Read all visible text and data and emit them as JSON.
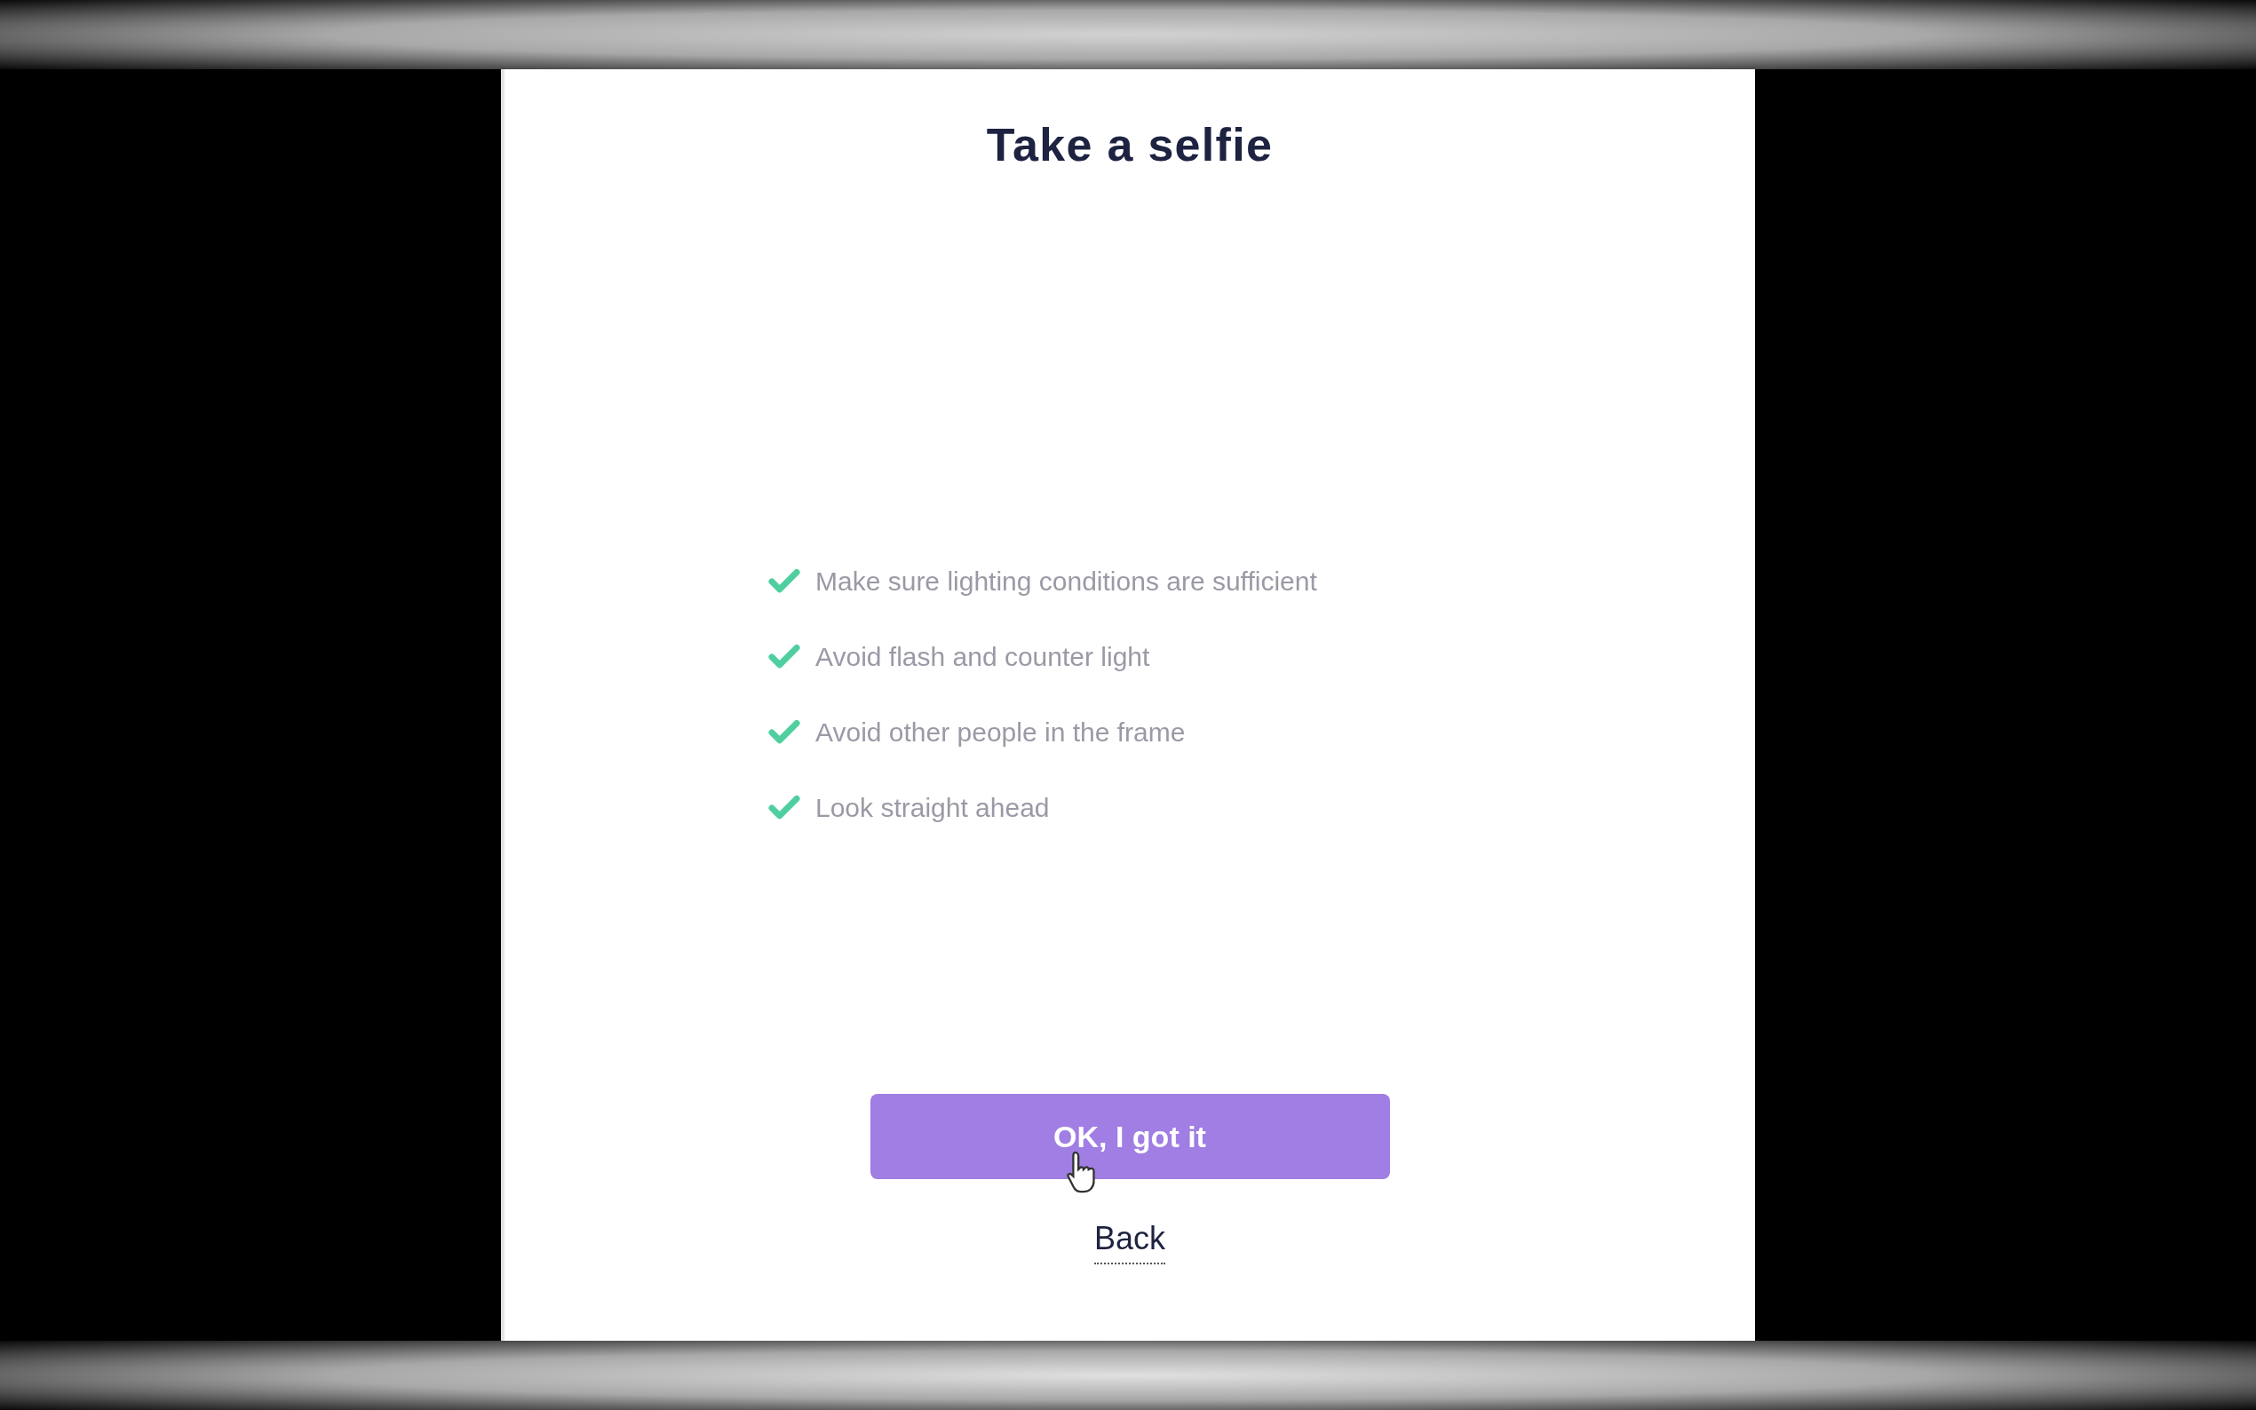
{
  "title": "Take a selfie",
  "tips": [
    {
      "text": "Make sure lighting conditions are sufficient"
    },
    {
      "text": "Avoid flash and counter light"
    },
    {
      "text": "Avoid other people in the frame"
    },
    {
      "text": "Look straight ahead"
    }
  ],
  "primary_button": {
    "label": "OK, I got it"
  },
  "back_link": {
    "label": "Back"
  }
}
